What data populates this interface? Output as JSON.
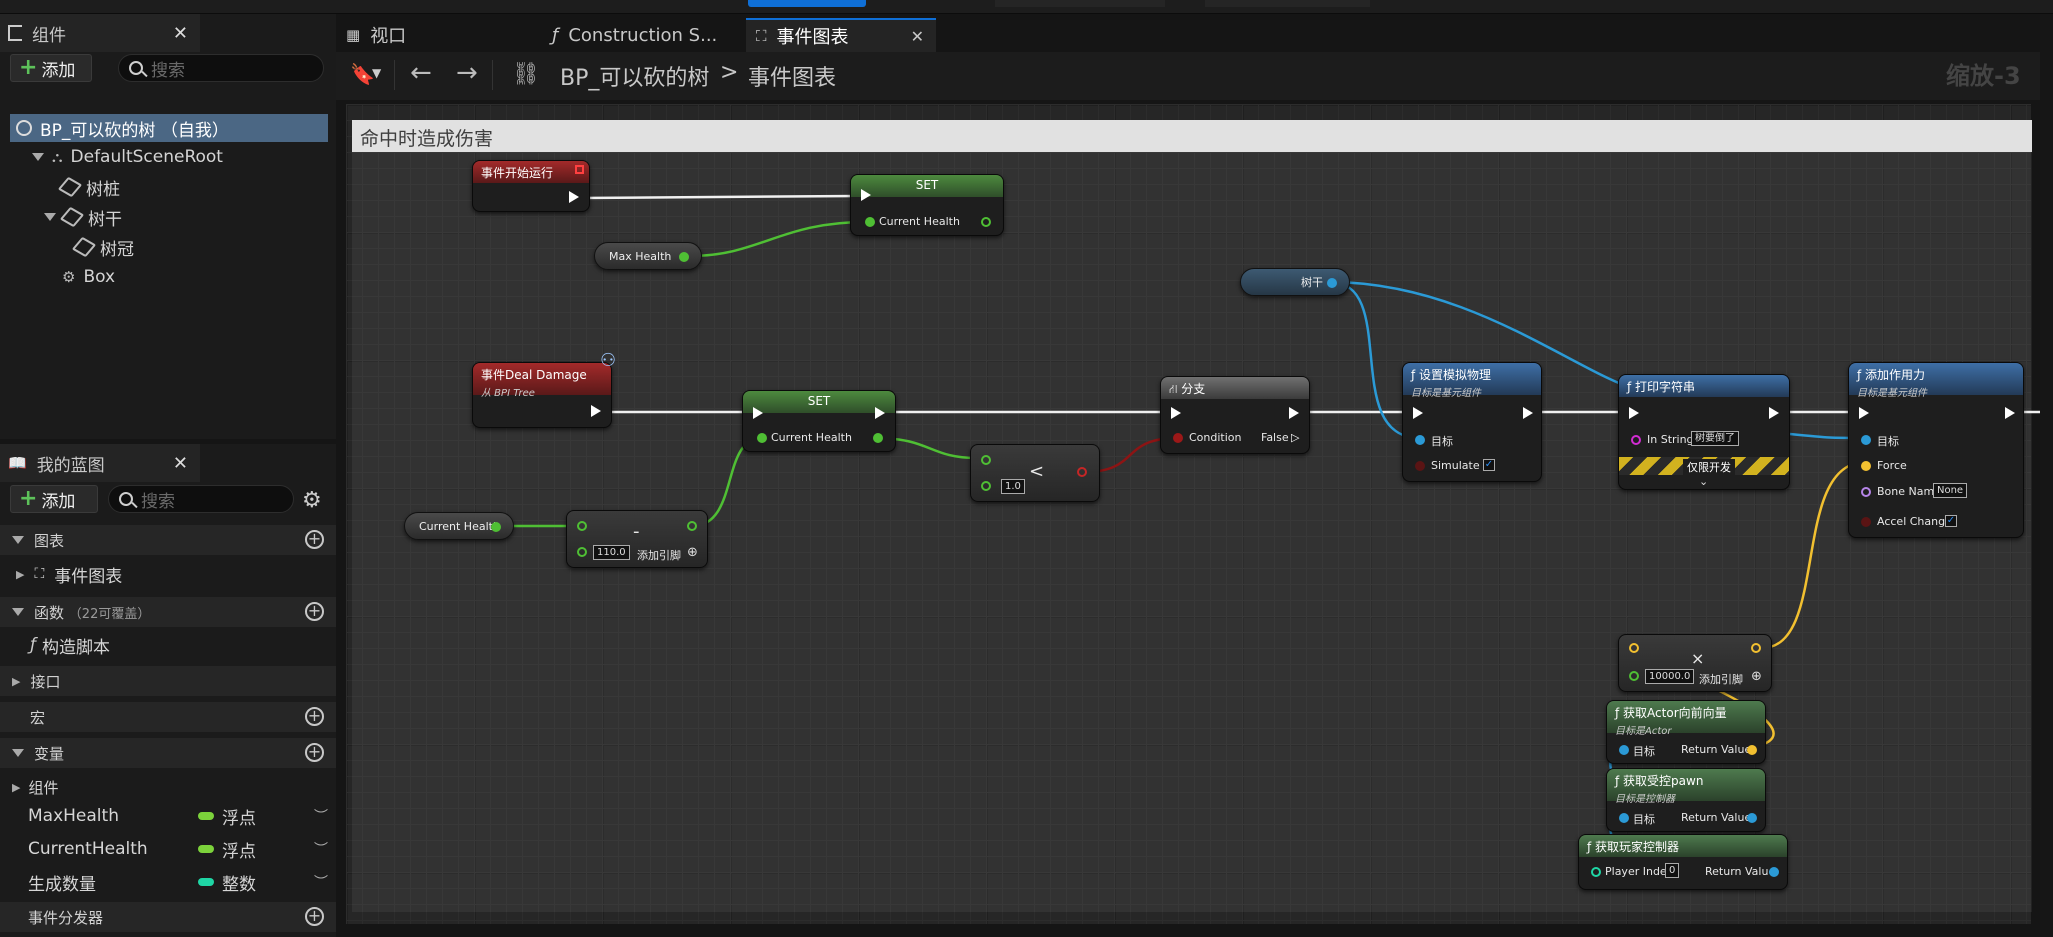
{
  "components_panel": {
    "tab_label": "组件",
    "add_label": "添加",
    "search_placeholder": "搜索",
    "tree": [
      {
        "label": "BP_可以砍的树 （自我）"
      },
      {
        "label": "DefaultSceneRoot"
      },
      {
        "label": "树桩"
      },
      {
        "label": "树干"
      },
      {
        "label": "树冠"
      },
      {
        "label": "Box"
      }
    ]
  },
  "my_blueprint": {
    "tab_label": "我的蓝图",
    "add_label": "添加",
    "search_placeholder": "搜索",
    "sections": {
      "graphs": "图表",
      "event_graph": "事件图表",
      "functions": "函数",
      "functions_note": "（22可覆盖）",
      "construction_script": "构造脚本",
      "interfaces": "接口",
      "macros": "宏",
      "variables": "变量",
      "components": "组件",
      "event_dispatchers": "事件分发器"
    },
    "variables": [
      {
        "name": "MaxHealth",
        "type": "浮点",
        "color": "#7cd23b"
      },
      {
        "name": "CurrentHealth",
        "type": "浮点",
        "color": "#7cd23b"
      },
      {
        "name": "生成数量",
        "type": "整数",
        "color": "#1fd6a5"
      }
    ]
  },
  "tabs": [
    {
      "label": "视口"
    },
    {
      "label": "Construction S..."
    },
    {
      "label": "事件图表"
    }
  ],
  "toolbar": {
    "breadcrumb_root": "BP_可以砍的树",
    "breadcrumb_sep": ">",
    "breadcrumb_leaf": "事件图表",
    "zoom": "缩放-3"
  },
  "graph": {
    "comment": "命中时造成伤害",
    "nodes": {
      "begin_play": {
        "title": "事件开始运行"
      },
      "set1": {
        "title": "SET",
        "pin": "Current Health"
      },
      "max_health": {
        "label": "Max Health"
      },
      "trunk_ref": {
        "label": "树干"
      },
      "deal_damage": {
        "title": "事件Deal Damage",
        "subtitle": "从 BPI Tree"
      },
      "set2": {
        "title": "SET",
        "pin": "Current Health"
      },
      "current_health": {
        "label": "Current Health"
      },
      "subtract": {
        "op": "-",
        "value": "110.0",
        "add_pin": "添加引脚"
      },
      "less": {
        "op": "<",
        "value": "1.0"
      },
      "branch": {
        "title": "分支",
        "condition": "Condition",
        "false": "False"
      },
      "set_physics": {
        "title": "设置模拟物理",
        "subtitle": "目标是基元组件",
        "target": "目标",
        "simulate": "Simulate"
      },
      "print": {
        "title": "打印字符串",
        "in_string": "In String",
        "value": "树要倒了",
        "dev_only": "仅限开发"
      },
      "add_force": {
        "title": "添加作用力",
        "subtitle": "目标是基元组件",
        "target": "目标",
        "force": "Force",
        "bone": "Bone Name",
        "bone_value": "None",
        "accel": "Accel Change"
      },
      "multiply": {
        "op": "×",
        "value": "10000.0",
        "add_pin": "添加引脚"
      },
      "forward": {
        "title": "获取Actor向前向量",
        "subtitle": "目标是Actor",
        "target": "目标",
        "ret": "Return Value"
      },
      "pawn": {
        "title": "获取受控pawn",
        "subtitle": "目标是控制器",
        "target": "目标",
        "ret": "Return Value"
      },
      "player_ctrl": {
        "title": "获取玩家控制器",
        "index": "Player Index",
        "index_value": "0",
        "ret": "Return Value"
      }
    }
  }
}
